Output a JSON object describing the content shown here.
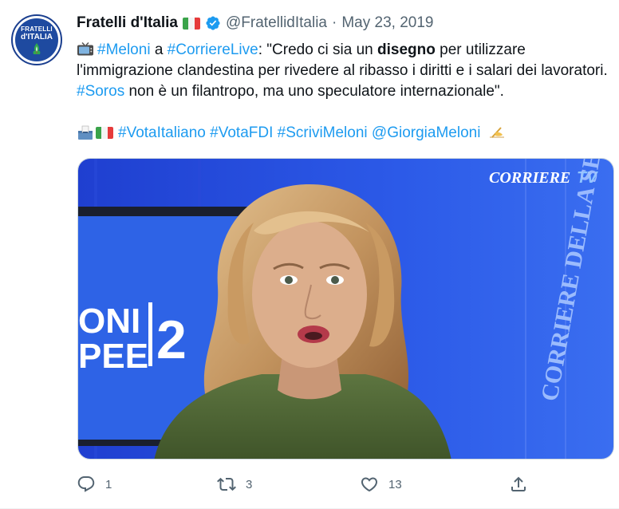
{
  "tweet": {
    "avatar": {
      "line1": "FRATELLI",
      "line2": "d'ITALIA"
    },
    "author": {
      "display_name": "Fratelli d'Italia",
      "handle": "@FratellidItalia",
      "separator": "·",
      "date": "May 23, 2019"
    },
    "text": {
      "p1": {
        "hashtag_meloni": "#Meloni",
        "a": " a ",
        "hashtag_corriere": "#CorriereLive",
        "quote_start": ": \"Credo ci sia un ",
        "bold_word": "disegno",
        "quote_rest": " per utilizzare l'immigrazione clandestina per rivedere al ribasso i diritti e i salari dei lavoratori. ",
        "hashtag_soros": "#Soros",
        "ending": " non è un filantropo, ma uno speculatore internazionale\"."
      },
      "p2": {
        "tag1": "#VotaItaliano",
        "tag2": "#VotaFDI",
        "tag3": "#ScriviMeloni",
        "mention": "@GiorgiaMeloni"
      }
    },
    "media": {
      "watermark": "CORRIERE",
      "watermark_tv": "TV",
      "side_text": "CORRIERE DELLA SERA",
      "screen_line1": "ONI",
      "screen_line2": "PEE",
      "screen_digit": "2"
    },
    "actions": {
      "reply_count": "1",
      "retweet_count": "3",
      "like_count": "13"
    },
    "colors": {
      "link": "#1d9bf0",
      "muted": "#536471",
      "verified": "#1d9bf0"
    },
    "icons": [
      "tv-icon",
      "verified-badge-icon",
      "flag-italy-icon",
      "ballot-box-icon",
      "writing-hand-icon",
      "reply-icon",
      "retweet-icon",
      "like-icon",
      "share-icon"
    ]
  }
}
